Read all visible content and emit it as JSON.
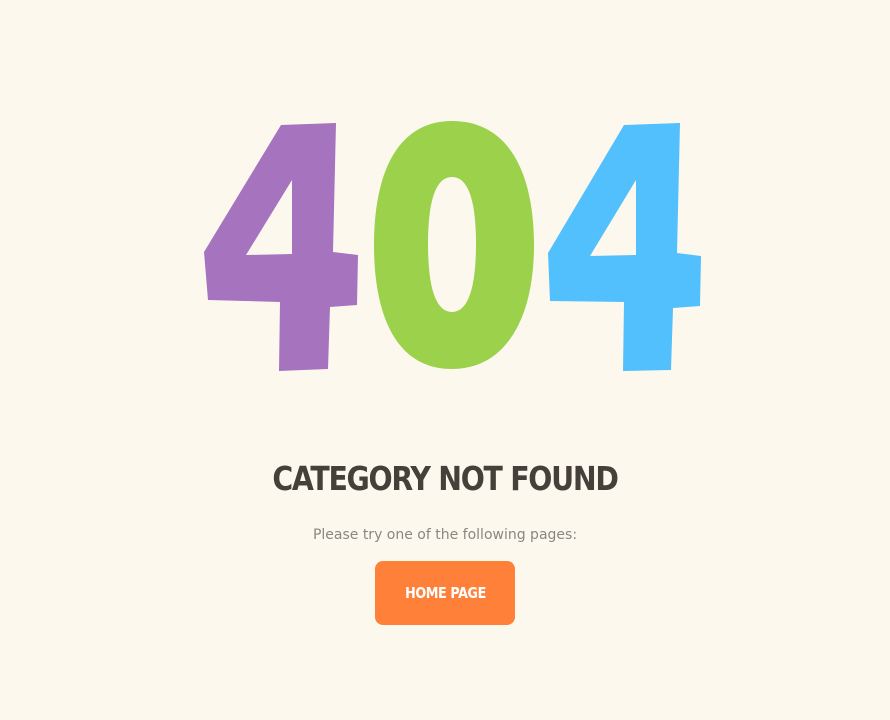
{
  "error_graphic": {
    "digits": [
      "4",
      "0",
      "4"
    ],
    "colors": [
      "#a673bf",
      "#9bd14b",
      "#52c0fc"
    ]
  },
  "heading": "CATEGORY NOT FOUND",
  "subtext": "Please try one of the following pages:",
  "home_button_label": "HOME PAGE",
  "colors": {
    "background": "#fdf8ee",
    "heading": "#45403a",
    "subtext": "#8a8680",
    "button": "#ff8038",
    "button_text": "#ffffff"
  }
}
